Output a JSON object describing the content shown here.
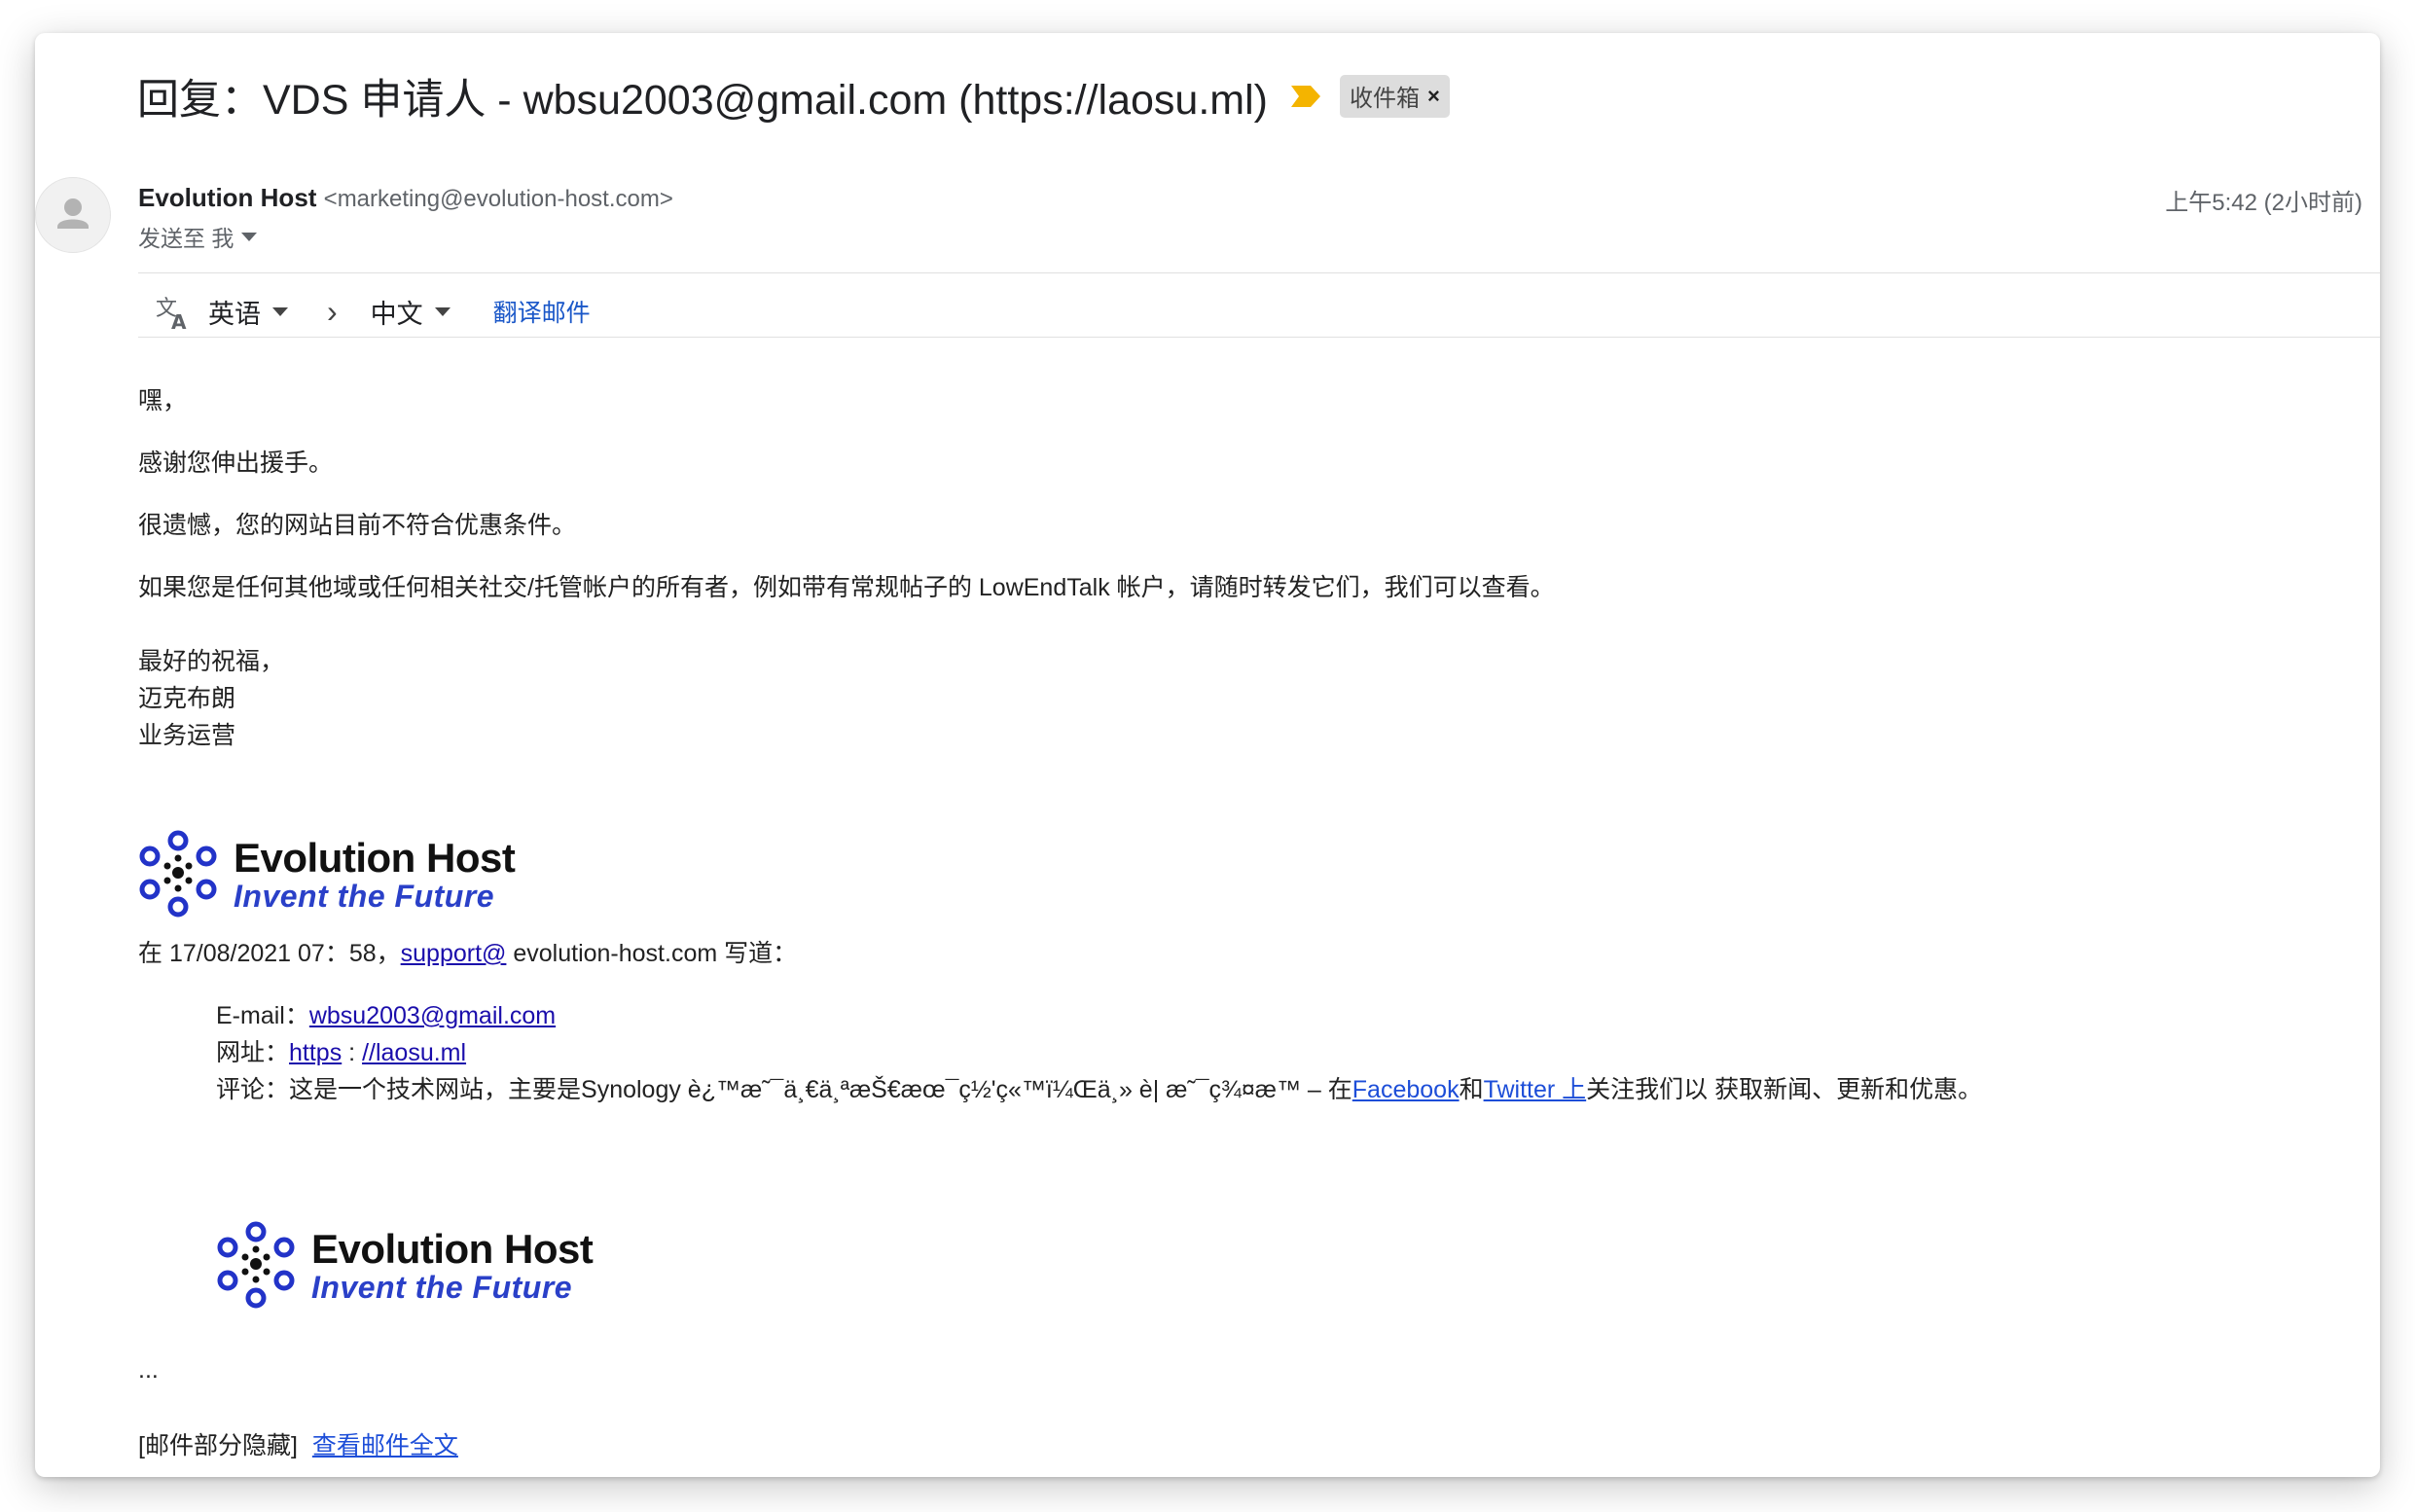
{
  "email": {
    "subject": "回复：VDS 申请人 - wbsu2003@gmail.com (https://laosu.ml)",
    "label": "收件箱",
    "label_remove": "×",
    "sender_name": "Evolution Host",
    "sender_email": "<marketing@evolution-host.com>",
    "to_line": "发送至 我",
    "date": "上午5:42 (2小时前)"
  },
  "translate": {
    "from_lang": "英语",
    "arrow": "›",
    "to_lang": "中文",
    "action": "翻译邮件"
  },
  "body": {
    "greeting": "嘿，",
    "p1": "感谢您伸出援手。",
    "p2": "很遗憾，您的网站目前不符合优惠条件。",
    "p3": "如果您是任何其他域或任何相关社交/托管帐户的所有者，例如带有常规帖子的 LowEndTalk 帐户，请随时转发它们，我们可以查看。",
    "sign1": "最好的祝福，",
    "sign2": "迈克布朗",
    "sign3": "业务运营"
  },
  "signature_logo": {
    "brand": "Evolution Host",
    "tagline": "Invent the Future"
  },
  "quote": {
    "intro_prefix": "在 17/08/2021 07：58，",
    "intro_link": "support@",
    "intro_suffix": " evolution-host.com 写道：",
    "email_label": "E-mail：",
    "email_value": "wbsu2003@gmail.com",
    "url_label": "网址：",
    "url_part1": "https",
    "url_sep": " : ",
    "url_part2": "//laosu.ml",
    "comment_label": "评论：",
    "comment_text": "这是一个技术网站，主要是Synology è¿™æ˜¯ä¸€ä¸ªæŠ€æœ¯ç½'ç«™ï¼Œä¸» è| æ˜¯ç¾¤æ™ – 在",
    "facebook": "Facebook",
    "and": "和",
    "twitter": "Twitter 上",
    "comment_tail": "关注我们以 获取新闻、更新和优惠。"
  },
  "footer": {
    "ellipsis": "...",
    "hidden_note": "[邮件部分隐藏]",
    "view_full": "查看邮件全文"
  },
  "colors": {
    "link": "#1a0dab",
    "translate_link": "#1a57c8",
    "brand_blue": "#2a40c8",
    "importance": "#f4b400",
    "chip_bg": "#dddddd"
  }
}
